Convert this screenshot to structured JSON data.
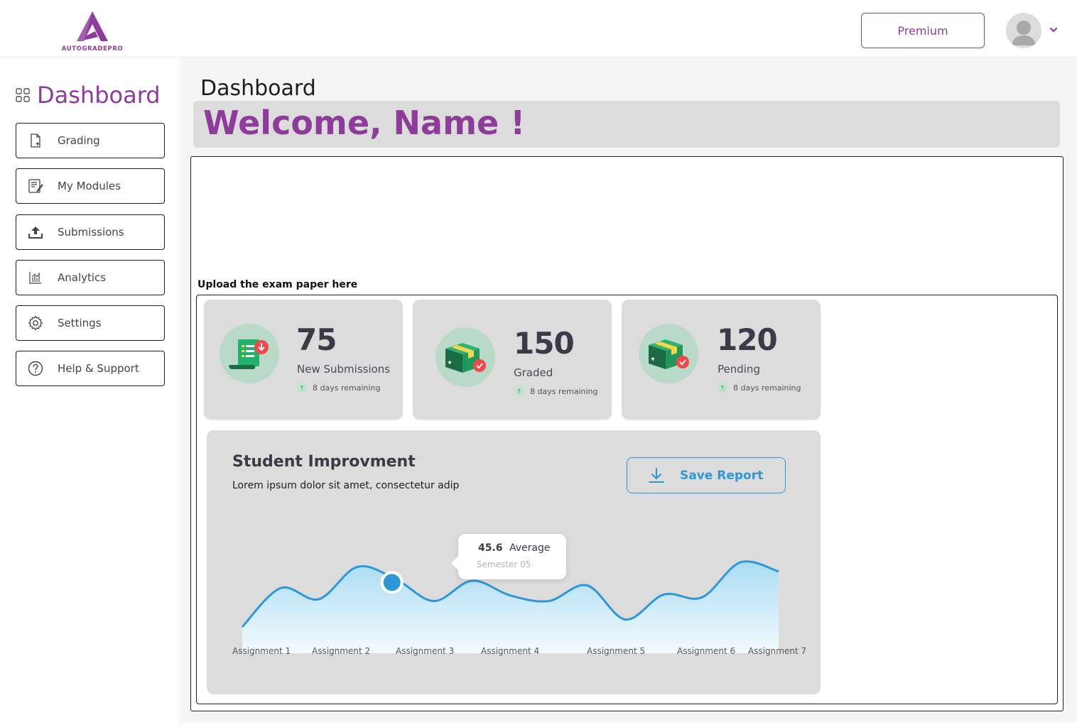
{
  "app": {
    "logo_text": "AUTOGRADEPRO",
    "brand_color": "#8e3c99",
    "accent_color": "#2f97d6"
  },
  "header": {
    "premium_label": "Premium",
    "avatar_icon": "user-avatar-icon",
    "menu_icon": "chevron-down-icon"
  },
  "sidebar": {
    "title": "Dashboard",
    "title_icon": "grid-icon",
    "items": [
      {
        "label": "Grading",
        "icon": "document-add-icon"
      },
      {
        "label": "My Modules",
        "icon": "module-notes-icon"
      },
      {
        "label": "Submissions",
        "icon": "upload-icon"
      },
      {
        "label": "Analytics",
        "icon": "analytics-chart-icon"
      },
      {
        "label": "Settings",
        "icon": "gear-icon"
      },
      {
        "label": "Help & Support",
        "icon": "help-circle-icon"
      }
    ]
  },
  "main": {
    "page_title": "Dashboard",
    "welcome": "Welcome, Name !",
    "upload_label": "Upload the exam paper here",
    "stats": [
      {
        "value": "75",
        "label": "New Submissions",
        "sub": "8 days remaining",
        "icon": "receipt-download-icon"
      },
      {
        "value": "150",
        "label": "Graded",
        "sub": "8 days remaining",
        "icon": "package-check-icon"
      },
      {
        "value": "120",
        "label": "Pending",
        "sub": "8 days remaining",
        "icon": "package-check-icon"
      }
    ],
    "improvement": {
      "title": "Student Improvment",
      "subtitle": "Lorem ipsum dolor sit amet, consectetur adip",
      "save_label": "Save Report",
      "save_icon": "download-icon",
      "tooltip_value": "45.6",
      "tooltip_label": "Average",
      "tooltip_sub": "Semester 05"
    }
  },
  "chart_data": {
    "type": "area",
    "title": "Student Improvment",
    "categories": [
      "Assignment 1",
      "Assignment 2",
      "Assignment 3",
      "Assignment 4",
      "Assignment 5",
      "Assignment 6",
      "Assignment 7"
    ],
    "series": [
      {
        "values": [
          10,
          52,
          40,
          75,
          62,
          38,
          60,
          44,
          38,
          55,
          18,
          45,
          42,
          80,
          70
        ]
      }
    ],
    "highlighted_point": {
      "label": "Average",
      "value": 45.6,
      "note": "Semester 05"
    },
    "grid": false,
    "line_color": "#2f97d6",
    "fill_color": "#bfe2f5"
  }
}
